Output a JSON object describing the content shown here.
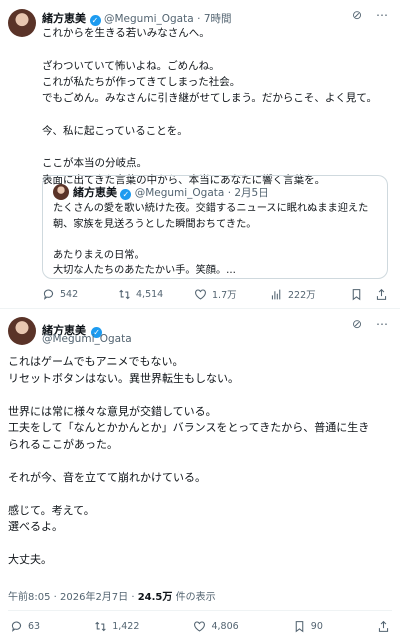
{
  "tweet1": {
    "author_name": "緒方恵美",
    "handle": "@Megumi_Ogata",
    "time": "· 7時間",
    "lines": [
      "これからを生きる若いみなさんへ。",
      "",
      "ざわついていて怖いよね。ごめんね。",
      "これが私たちが作ってきてしまった社会。",
      "でもごめん。みなさんに引き継がせてしまう。だからこそ、よく見て。",
      "",
      "今、私に起こっていることを。",
      "",
      "ここが本当の分岐点。",
      "表面に出てきた言葉の中から、本当にあなたに響く言葉を。"
    ],
    "quote": {
      "author_name": "緒方恵美",
      "handle": "@Megumi_Ogata",
      "date": "· 2月5日",
      "lines": [
        "たくさんの愛を歌い続けた夜。交錯するニュースに眠れぬまま迎えた",
        "朝、家族を見送ろうとした瞬間おちてきた。",
        "",
        "あたりまえの日常。",
        "大切な人たちのあたたかい手。笑顔。..."
      ]
    },
    "actions": {
      "replies": "542",
      "reposts": "4,514",
      "likes": "1.7万",
      "views": "222万"
    }
  },
  "tweet2": {
    "author_name": "緒方恵美",
    "handle": "@Megumi_Ogata",
    "lines": [
      "これはゲームでもアニメでもない。",
      "リセットボタンはない。異世界転生もしない。",
      "",
      "世界には常に様々な意見が交錯している。",
      "工夫をして「なんとかかんとか」バランスをとってきたから、普通に生き",
      "られるここがあった。",
      "",
      "それが今、音を立てて崩れかけている。",
      "",
      "感じて。考えて。",
      "選べるよ。",
      "",
      "大丈夫。"
    ],
    "meta": {
      "time_date": "午前8:05 · 2026年2月7日 · ",
      "views": "24.5万",
      "views_suffix": " 件の表示"
    },
    "actions": {
      "replies": "63",
      "reposts": "1,422",
      "likes": "4,806",
      "bookmarks": "90"
    }
  },
  "icons": [
    "grok-icon",
    "more-icon",
    "reply-icon",
    "repost-icon",
    "like-icon",
    "views-icon",
    "bookmark-icon",
    "share-icon",
    "verified-badge-icon"
  ],
  "colors": {
    "verified": "#1d9bf0",
    "muted": "#536471",
    "border": "#cfd9de"
  }
}
